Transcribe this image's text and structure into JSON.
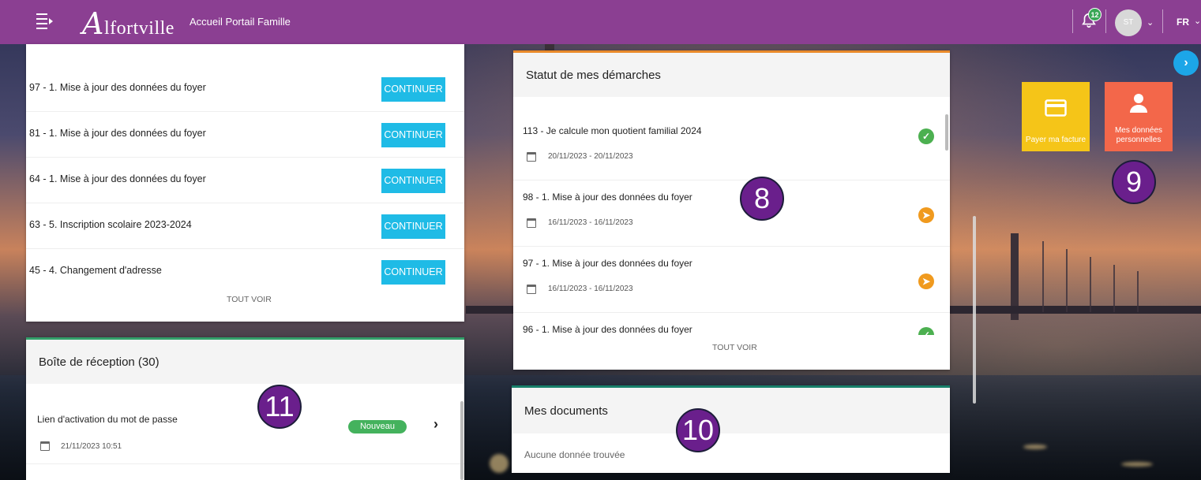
{
  "header": {
    "logo_initial": "A",
    "logo_rest": "lfortville",
    "title": "Accueil Portail Famille",
    "notification_count": "12",
    "avatar_initials": "ST",
    "language": "FR",
    "brand_color": "#8b3f92"
  },
  "pending": {
    "items": [
      {
        "label": "97 - 1. Mise à jour des données du foyer",
        "action": "CONTINUER"
      },
      {
        "label": "81 - 1. Mise à jour des données du foyer",
        "action": "CONTINUER"
      },
      {
        "label": "64 - 1. Mise à jour des données du foyer",
        "action": "CONTINUER"
      },
      {
        "label": "63 - 5. Inscription scolaire 2023-2024",
        "action": "CONTINUER"
      },
      {
        "label": "45 - 4. Changement d'adresse",
        "action": "CONTINUER"
      }
    ],
    "see_all": "TOUT VOIR"
  },
  "inbox": {
    "title": "Boîte de réception  (30)",
    "items": [
      {
        "title": "Lien d'activation du mot de passe",
        "date": "21/11/2023 10:51",
        "badge": "Nouveau"
      }
    ]
  },
  "status": {
    "title": "Statut de mes démarches",
    "items": [
      {
        "title": "113 - Je calcule mon quotient familial 2024",
        "date": "20/11/2023 - 20/11/2023",
        "state": "done"
      },
      {
        "title": "98 - 1. Mise à jour des données du foyer",
        "date": "16/11/2023 - 16/11/2023",
        "state": "in-progress"
      },
      {
        "title": "97 - 1. Mise à jour des données du foyer",
        "date": "16/11/2023 - 16/11/2023",
        "state": "in-progress"
      },
      {
        "title": "96 - 1. Mise à jour des données du foyer",
        "date": "",
        "state": "done"
      }
    ],
    "see_all": "TOUT VOIR"
  },
  "documents": {
    "title": "Mes documents",
    "empty_text": "Aucune donnée trouvée"
  },
  "quick_actions": [
    {
      "label": "Payer ma facture",
      "icon": "credit-card-icon",
      "color": "#f5c518"
    },
    {
      "label": "Mes données personnelles",
      "icon": "person-icon",
      "color": "#f3674a"
    }
  ],
  "callouts": [
    "8",
    "9",
    "10",
    "11"
  ]
}
